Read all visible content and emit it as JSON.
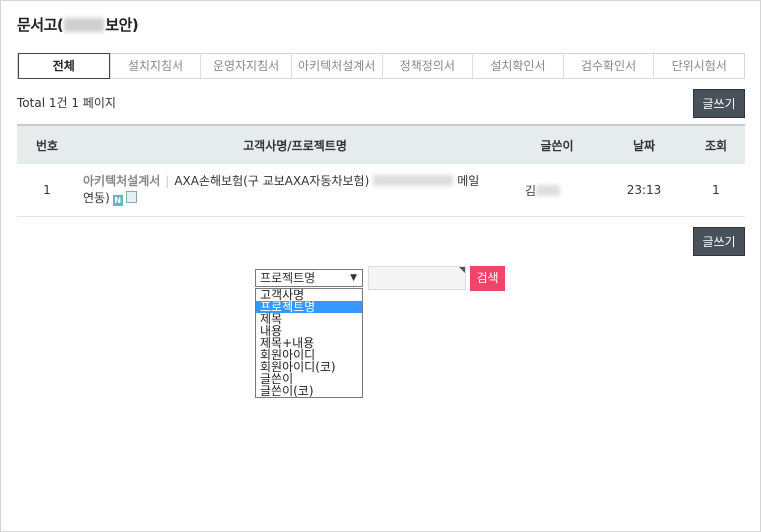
{
  "page": {
    "title_prefix": "문서고(",
    "title_suffix": "보안)"
  },
  "tabs": [
    {
      "label": "전체",
      "active": true
    },
    {
      "label": "설치지침서"
    },
    {
      "label": "운영자지침서"
    },
    {
      "label": "아키텍처설계서"
    },
    {
      "label": "정책정의서"
    },
    {
      "label": "설치확인서"
    },
    {
      "label": "검수확인서"
    },
    {
      "label": "단위시험서"
    }
  ],
  "summary": {
    "total_text": "Total 1건 1 페이지"
  },
  "buttons": {
    "write_label": "글쓰기",
    "search_label": "검색"
  },
  "table": {
    "headers": {
      "no": "번호",
      "title": "고객사명/프로젝트명",
      "writer": "글쓴이",
      "date": "날짜",
      "views": "조회"
    },
    "rows": [
      {
        "no": "1",
        "category": "아키텍처설계서",
        "title_part1": "AXA손해보험(구 교보AXA자동차보험)",
        "title_part2": "메일",
        "title_part3": "연동)",
        "writer": "김",
        "date": "23:13",
        "views": "1"
      }
    ]
  },
  "search": {
    "selected": "프로젝트명",
    "options": [
      "고객사명",
      "프로젝트명",
      "제목",
      "내용",
      "제목+내용",
      "회원아이디",
      "회원아이디(코)",
      "글쓴이",
      "글쓴이(코)"
    ]
  },
  "icons": {
    "new": "new-badge-icon",
    "file": "file-icon"
  },
  "colors": {
    "search_button": "#f0446a",
    "write_button": "#49515a",
    "selected_option": "#3399ff"
  }
}
